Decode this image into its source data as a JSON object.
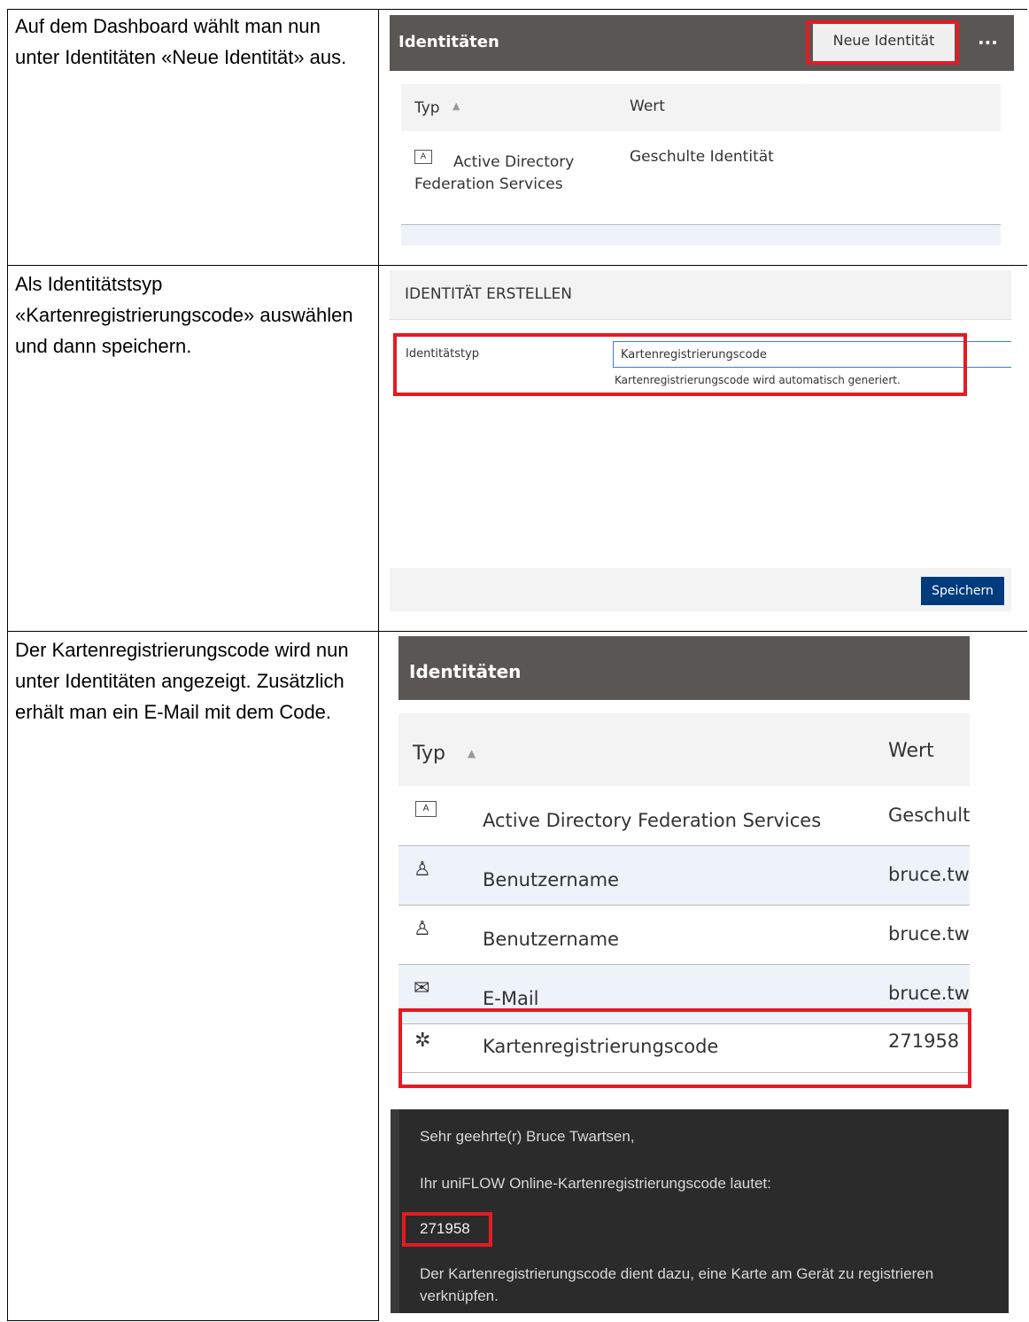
{
  "steps": [
    {
      "text": "Auf dem Dashboard wählt man nun unter Identitäten «Neue Identität» aus."
    },
    {
      "text": "Als Identitätstsyp «Kartenregistrierungscode» auswählen und dann speichern."
    },
    {
      "text": "Der Kartenregistrierungscode wird nun unter Identitäten angezeigt. Zusätzlich erhält man ein E-Mail mit dem Code."
    }
  ],
  "shot1": {
    "header_title": "Identitäten",
    "new_button": "Neue Identität",
    "more_button": "...",
    "col_type": "Typ",
    "col_value": "Wert",
    "row_type": "Active Directory Federation Services",
    "row_value": "Geschulte Identität"
  },
  "shot2": {
    "title": "IDENTITÄT ERSTELLEN",
    "field_label": "Identitätstyp",
    "field_value": "Kartenregistrierungscode",
    "field_hint": "Kartenregistrierungscode wird automatisch generiert.",
    "save_button": "Speichern"
  },
  "shot3": {
    "header_title": "Identitäten",
    "col_type": "Typ",
    "col_value": "Wert",
    "rows": [
      {
        "type": "Active Directory Federation Services",
        "value": "Geschulte",
        "icon": "id-card-icon"
      },
      {
        "type": "Benutzername",
        "value": "bruce.twa",
        "icon": "user-lock-icon"
      },
      {
        "type": "Benutzername",
        "value": "bruce.twa",
        "icon": "user-lock-icon"
      },
      {
        "type": "E-Mail",
        "value": "bruce.twa",
        "icon": "envelope-icon"
      },
      {
        "type": "Kartenregistrierungscode",
        "value": "271958",
        "icon": "puzzle-icon"
      }
    ]
  },
  "email": {
    "greeting": "Sehr geehrte(r) Bruce Twartsen,",
    "line1": "Ihr uniFLOW Online-Kartenregistrierungscode lautet:",
    "code": "271958",
    "line2": "Der Kartenregistrierungscode dient dazu, eine Karte am Gerät zu registrieren",
    "line3": "verknüpfen."
  },
  "colors": {
    "highlight": "#e31b23",
    "header_bg": "#5a5653",
    "email_bg": "#2b2b2b",
    "save_button_bg": "#003b7d"
  }
}
